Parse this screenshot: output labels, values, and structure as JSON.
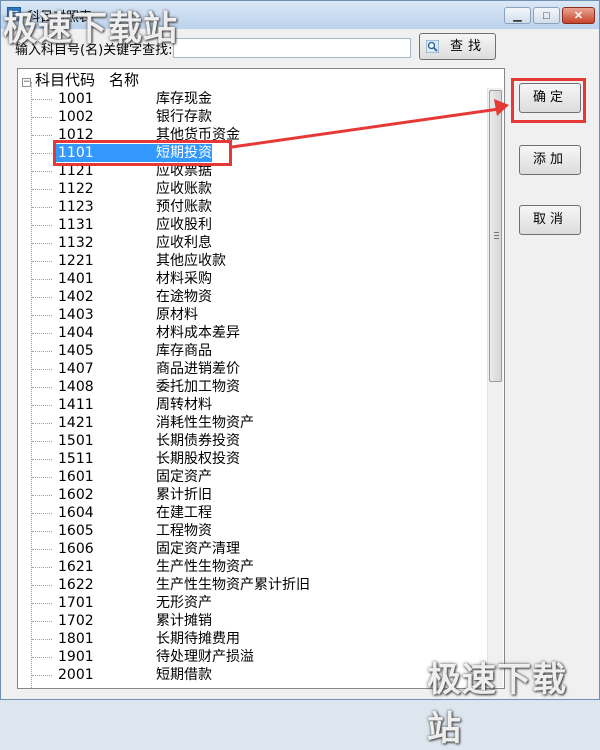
{
  "window": {
    "title": "科目对照表",
    "controls": {
      "minimize": "▁",
      "maximize": "□",
      "close": "✕"
    }
  },
  "watermark": {
    "text": "极速下载站"
  },
  "search": {
    "label": "输入科目号(名)关键字查找:",
    "value": "",
    "button_label": "查找",
    "button_icon": "magnifier-icon"
  },
  "buttons": {
    "ok": "确定",
    "add": "添加",
    "cancel": "取消"
  },
  "tree": {
    "header_code": "科目代码",
    "header_name": "名称",
    "selected_code": "1101",
    "rows": [
      {
        "code": "1001",
        "name": "库存现金"
      },
      {
        "code": "1002",
        "name": "银行存款"
      },
      {
        "code": "1012",
        "name": "其他货币资金"
      },
      {
        "code": "1101",
        "name": "短期投资"
      },
      {
        "code": "1121",
        "name": "应收票据"
      },
      {
        "code": "1122",
        "name": "应收账款"
      },
      {
        "code": "1123",
        "name": "预付账款"
      },
      {
        "code": "1131",
        "name": "应收股利"
      },
      {
        "code": "1132",
        "name": "应收利息"
      },
      {
        "code": "1221",
        "name": "其他应收款"
      },
      {
        "code": "1401",
        "name": "材料采购"
      },
      {
        "code": "1402",
        "name": "在途物资"
      },
      {
        "code": "1403",
        "name": "原材料"
      },
      {
        "code": "1404",
        "name": "材料成本差异"
      },
      {
        "code": "1405",
        "name": "库存商品"
      },
      {
        "code": "1407",
        "name": "商品进销差价"
      },
      {
        "code": "1408",
        "name": "委托加工物资"
      },
      {
        "code": "1411",
        "name": "周转材料"
      },
      {
        "code": "1421",
        "name": "消耗性生物资产"
      },
      {
        "code": "1501",
        "name": "长期债券投资"
      },
      {
        "code": "1511",
        "name": "长期股权投资"
      },
      {
        "code": "1601",
        "name": "固定资产"
      },
      {
        "code": "1602",
        "name": "累计折旧"
      },
      {
        "code": "1604",
        "name": "在建工程"
      },
      {
        "code": "1605",
        "name": "工程物资"
      },
      {
        "code": "1606",
        "name": "固定资产清理"
      },
      {
        "code": "1621",
        "name": "生产性生物资产"
      },
      {
        "code": "1622",
        "name": "生产性生物资产累计折旧"
      },
      {
        "code": "1701",
        "name": "无形资产"
      },
      {
        "code": "1702",
        "name": "累计摊销"
      },
      {
        "code": "1801",
        "name": "长期待摊费用"
      },
      {
        "code": "1901",
        "name": "待处理财产损溢"
      },
      {
        "code": "2001",
        "name": "短期借款"
      }
    ]
  },
  "colors": {
    "selection": "#3399ff",
    "annotation_red": "#e53935"
  }
}
